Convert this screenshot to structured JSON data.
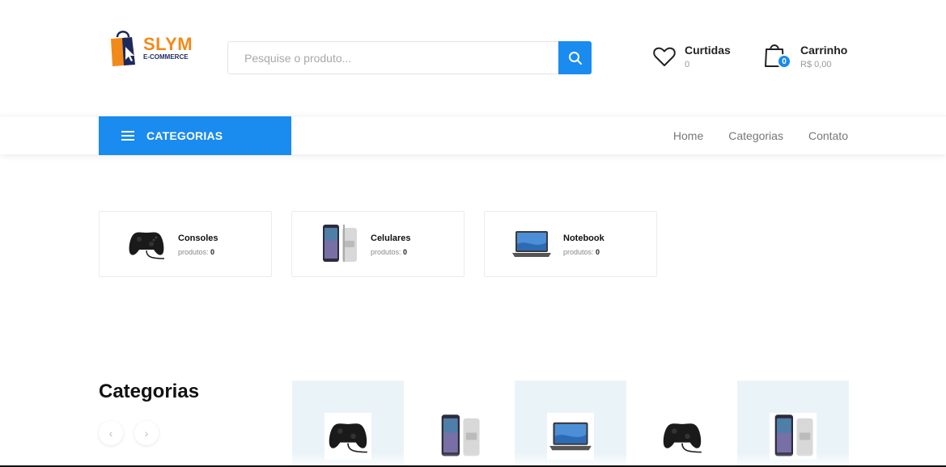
{
  "brand": {
    "name": "SLYM",
    "tagline": "E-COMMERCE"
  },
  "search": {
    "placeholder": "Pesquise o produto..."
  },
  "favorites": {
    "title": "Curtidas",
    "count": "0"
  },
  "cart": {
    "title": "Carrinho",
    "total": "R$ 0,00",
    "badge": "0"
  },
  "nav": {
    "categories_button": "CATEGORIAS",
    "menu": [
      "Home",
      "Categorias",
      "Contato"
    ]
  },
  "category_cards": [
    {
      "name": "Consoles",
      "count_label": "produtos:",
      "count": "0",
      "icon": "controller-icon"
    },
    {
      "name": "Celulares",
      "count_label": "produtos:",
      "count": "0",
      "icon": "phone-icon"
    },
    {
      "name": "Notebook",
      "count_label": "produtos:",
      "count": "0",
      "icon": "laptop-icon"
    }
  ],
  "section": {
    "title": "Categorias"
  },
  "carousel": [
    "controller-icon",
    "phone-icon",
    "laptop-icon",
    "controller-icon",
    "phone-icon"
  ],
  "colors": {
    "primary": "#1a8bef",
    "brand_orange": "#f28a1a",
    "brand_navy": "#1b2a5c"
  }
}
